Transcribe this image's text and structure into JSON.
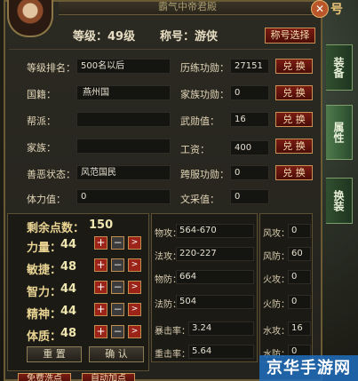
{
  "header": {
    "title_strip": "霸气中帝君殿",
    "level_label": "等级：49级",
    "title_label": "称号：游侠",
    "title_select_button": "称号选择",
    "close": "✕",
    "corner_text": "号"
  },
  "info_rows": [
    {
      "left_label": "等级排名：",
      "left_value": "500名以后",
      "right_label": "历练功勋：",
      "right_value": "27151",
      "button": "兑 换"
    },
    {
      "left_label": "国籍：",
      "left_value": "燕州国",
      "right_label": "家族功勋：",
      "right_value": "0",
      "button": "兑 换"
    },
    {
      "left_label": "帮派：",
      "left_value": "",
      "right_label": "武勋值：",
      "right_value": "16",
      "button": "兑 换"
    },
    {
      "left_label": "家族：",
      "left_value": "",
      "right_label": "工资：",
      "right_value": "400",
      "button": "兑 换"
    },
    {
      "left_label": "善恶状态：",
      "left_value": "风范国民",
      "right_label": "跨服功勋：",
      "right_value": "0",
      "button": "兑 换"
    },
    {
      "left_label": "体力值：",
      "left_value": "0",
      "right_label": "文采值：",
      "right_value": "0",
      "button": ""
    }
  ],
  "points": {
    "remaining_label": "剩余点数：",
    "remaining_value": "150",
    "attrs": [
      {
        "label": "力量：",
        "value": "44"
      },
      {
        "label": "敏捷：",
        "value": "48"
      },
      {
        "label": "智力：",
        "value": "44"
      },
      {
        "label": "精神：",
        "value": "44"
      },
      {
        "label": "体质：",
        "value": "48"
      }
    ],
    "reset_button": "重 置",
    "confirm_button": "确 认"
  },
  "combat_stats": [
    {
      "label": "物攻：",
      "value": "564-670"
    },
    {
      "label": "法攻：",
      "value": "220-227"
    },
    {
      "label": "物防：",
      "value": "664"
    },
    {
      "label": "法防：",
      "value": "504"
    },
    {
      "label": "暴击率：",
      "value": "3.24"
    },
    {
      "label": "重击率：",
      "value": "5.64"
    }
  ],
  "resist_stats": [
    {
      "label": "风攻：",
      "value": "0"
    },
    {
      "label": "风防：",
      "value": "60"
    },
    {
      "label": "火攻：",
      "value": "0"
    },
    {
      "label": "火防：",
      "value": "0"
    },
    {
      "label": "水攻：",
      "value": "16"
    },
    {
      "label": "水防：",
      "value": "0"
    }
  ],
  "tabs": [
    {
      "label": "装备"
    },
    {
      "label": "属性"
    },
    {
      "label": "换装"
    }
  ],
  "bottom_buttons": [
    "免费洗点",
    "自动加点"
  ],
  "watermark": "京华手游网",
  "colors": {
    "accent": "#9c2318",
    "gold_text": "#e9d493",
    "tab_active": "#4f7b4c"
  }
}
